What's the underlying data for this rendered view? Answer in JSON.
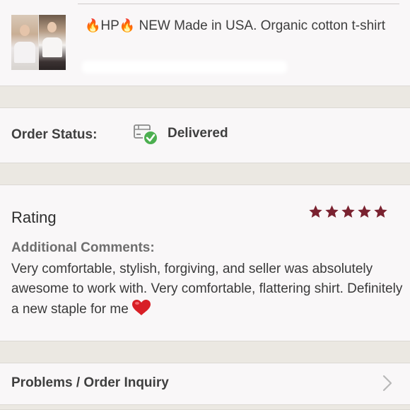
{
  "item": {
    "title_flame": "🔥",
    "title_hp": "HP",
    "title_rest": " NEW Made in USA. Organic cotton t-shirt",
    "subtitle_redacted": true
  },
  "order_status": {
    "label": "Order Status:",
    "value": "Delivered",
    "icon": "package-delivered-icon",
    "icon_color": "#4caf50"
  },
  "rating": {
    "label": "Rating",
    "stars": 5,
    "star_color": "#7a2230",
    "comments_label": "Additional Comments:",
    "comment": "Very comfortable, stylish, forgiving, and seller was absolutely awesome to work with. Very comfortable, flattering shirt. Definitely a new staple for me",
    "comment_emoji": "heart-icon"
  },
  "problems": {
    "label": "Problems / Order Inquiry",
    "icon": "chevron-right-icon"
  }
}
